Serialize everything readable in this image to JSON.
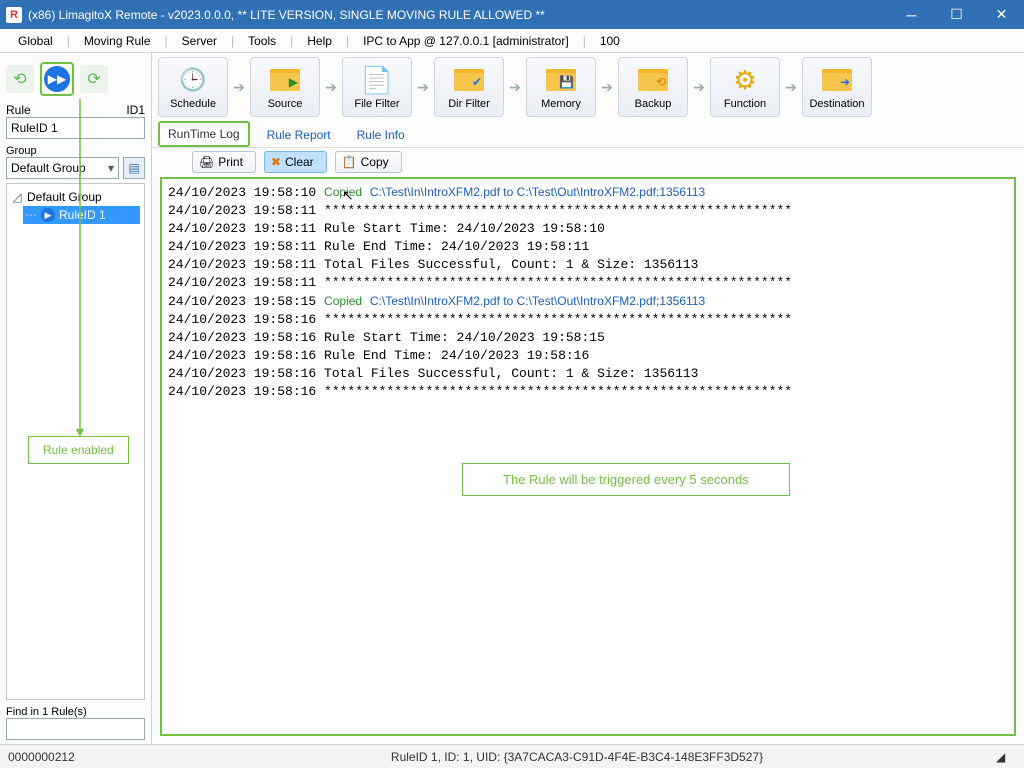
{
  "title": "(x86) LimagitoX Remote - v2023.0.0.0,  ** LITE VERSION, SINGLE MOVING RULE ALLOWED **",
  "menu": {
    "global": "Global",
    "moving_rule": "Moving Rule",
    "server": "Server",
    "tools": "Tools",
    "help": "Help",
    "ipc": "IPC to App @ 127.0.0.1 [administrator]",
    "num": "100"
  },
  "left": {
    "rule_label": "Rule",
    "id_label": "ID1",
    "rule_value": "RuleID 1",
    "group_label": "Group",
    "group_value": "Default Group",
    "tree_root": "Default Group",
    "tree_item": "RuleID 1",
    "find_label": "Find in 1 Rule(s)",
    "find_value": ""
  },
  "toolbar": {
    "schedule": "Schedule",
    "source": "Source",
    "file_filter": "File Filter",
    "dir_filter": "Dir Filter",
    "memory": "Memory",
    "backup": "Backup",
    "function": "Function",
    "destination": "Destination"
  },
  "subtabs": {
    "runtime": "RunTime Log",
    "report": "Rule Report",
    "info": "Rule Info"
  },
  "logbtn": {
    "print": "Print",
    "clear": "Clear",
    "copy": "Copy"
  },
  "log": [
    {
      "ts": "24/10/2023 19:58:10",
      "kind": "copied",
      "src": "C:\\Test\\In\\IntroXFM2.pdf",
      "dst": "C:\\Test\\Out\\IntroXFM2.pdf",
      "size": "1356113"
    },
    {
      "ts": "24/10/2023 19:58:11",
      "kind": "stars"
    },
    {
      "ts": "24/10/2023 19:58:11",
      "kind": "text",
      "msg": "Rule Start Time: 24/10/2023 19:58:10"
    },
    {
      "ts": "24/10/2023 19:58:11",
      "kind": "text",
      "msg": "Rule End Time: 24/10/2023 19:58:11"
    },
    {
      "ts": "24/10/2023 19:58:11",
      "kind": "text",
      "msg": "Total Files Successful, Count: 1 & Size: 1356113"
    },
    {
      "ts": "24/10/2023 19:58:11",
      "kind": "stars"
    },
    {
      "ts": "24/10/2023 19:58:15",
      "kind": "copied",
      "src": "C:\\Test\\In\\IntroXFM2.pdf",
      "dst": "C:\\Test\\Out\\IntroXFM2.pdf",
      "size": "1356113"
    },
    {
      "ts": "24/10/2023 19:58:16",
      "kind": "stars"
    },
    {
      "ts": "24/10/2023 19:58:16",
      "kind": "text",
      "msg": "Rule Start Time: 24/10/2023 19:58:15"
    },
    {
      "ts": "24/10/2023 19:58:16",
      "kind": "text",
      "msg": "Rule End Time: 24/10/2023 19:58:16"
    },
    {
      "ts": "24/10/2023 19:58:16",
      "kind": "text",
      "msg": "Total Files Successful, Count: 1 & Size: 1356113"
    },
    {
      "ts": "24/10/2023 19:58:16",
      "kind": "stars"
    }
  ],
  "note": "The Rule will be triggered every 5 seconds",
  "rule_enabled": "Rule enabled",
  "status": {
    "left": "0000000212",
    "mid": "RuleID 1, ID: 1, UID: {3A7CACA3-C91D-4F4E-B3C4-148E3FF3D527}"
  }
}
